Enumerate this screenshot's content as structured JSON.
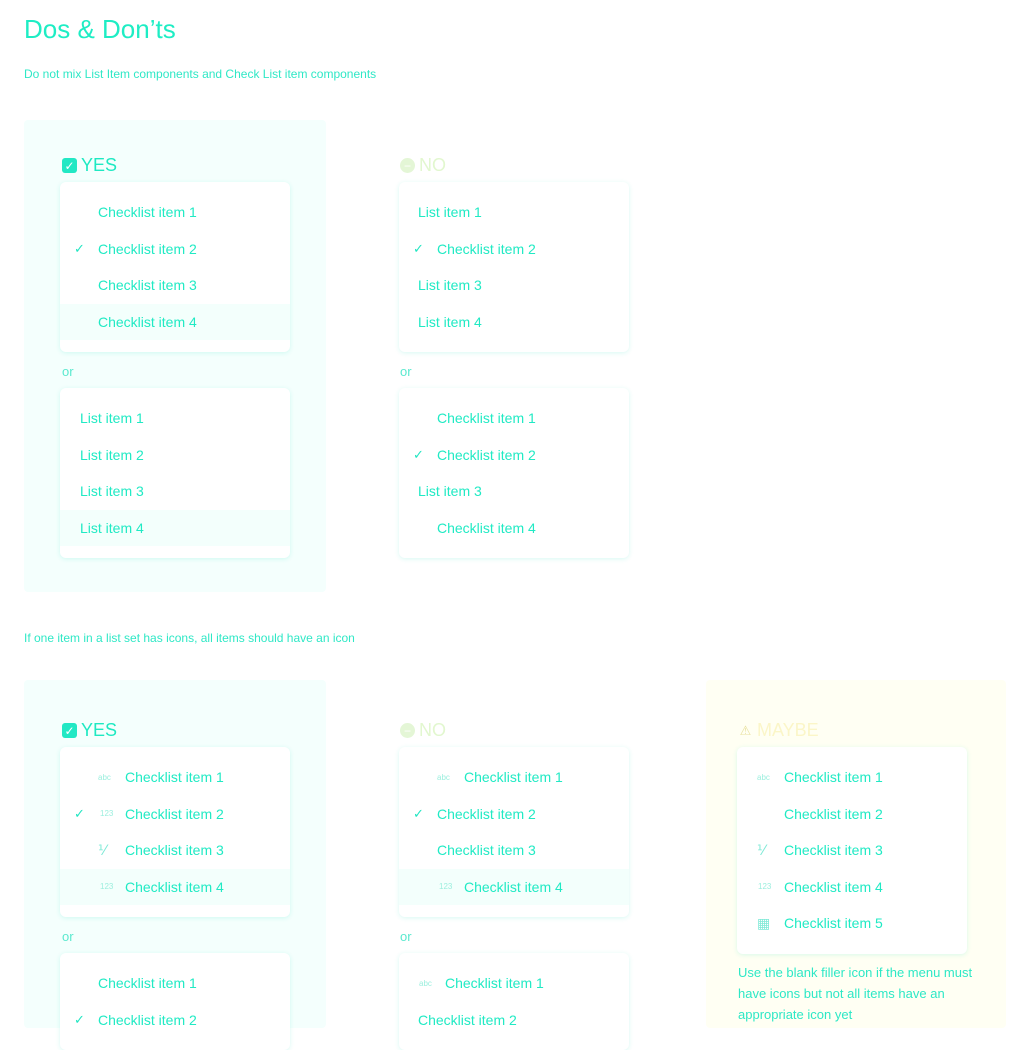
{
  "page": {
    "title": "Dos & Don’ts",
    "section1_note": "Do not mix List Item components and Check List item components",
    "section2_note": "If one item in a list set has icons, all items should have an icon"
  },
  "labels": {
    "yes": "YES",
    "no": "NO",
    "maybe": "MAYBE",
    "or": "or"
  },
  "icons": {
    "yes": "checkbox-checked-icon",
    "no": "minus-circle-icon",
    "maybe": "warning-icon",
    "check": "checkmark-icon",
    "abc": "abc-icon",
    "num": "123-icon",
    "fraction": "fraction-icon",
    "calendar": "calendar-icon"
  },
  "colors": {
    "accent": "#20f0c8",
    "yes_bg": "#f4fffd",
    "no": "#e2f7cf",
    "maybe": "#fbf6c8"
  },
  "section1": {
    "yes_a": [
      "Checklist item 1",
      "Checklist item 2",
      "Checklist item 3",
      "Checklist item 4"
    ],
    "yes_b": [
      "List item 1",
      "List item 2",
      "List item 3",
      "List item 4"
    ],
    "no_a": [
      "List item 1",
      "Checklist item 2",
      "List item 3",
      "List item 4"
    ],
    "no_b": [
      "Checklist item 1",
      "Checklist item 2",
      "List item 3",
      "Checklist item 4"
    ]
  },
  "section2": {
    "yes_a": [
      "Checklist item 1",
      "Checklist item 2",
      "Checklist item 3",
      "Checklist item 4"
    ],
    "yes_b": [
      "Checklist item 1",
      "Checklist item 2"
    ],
    "no_a": [
      "Checklist item 1",
      "Checklist item 2",
      "Checklist item 3",
      "Checklist item 4"
    ],
    "no_b": [
      "Checklist item 1",
      "Checklist item 2"
    ],
    "maybe": [
      "Checklist item 1",
      "Checklist item 2",
      "Checklist item 3",
      "Checklist item 4",
      "Checklist item 5"
    ],
    "maybe_note": "Use the blank filler icon if the menu must have icons but not all items have an appropriate icon yet"
  }
}
